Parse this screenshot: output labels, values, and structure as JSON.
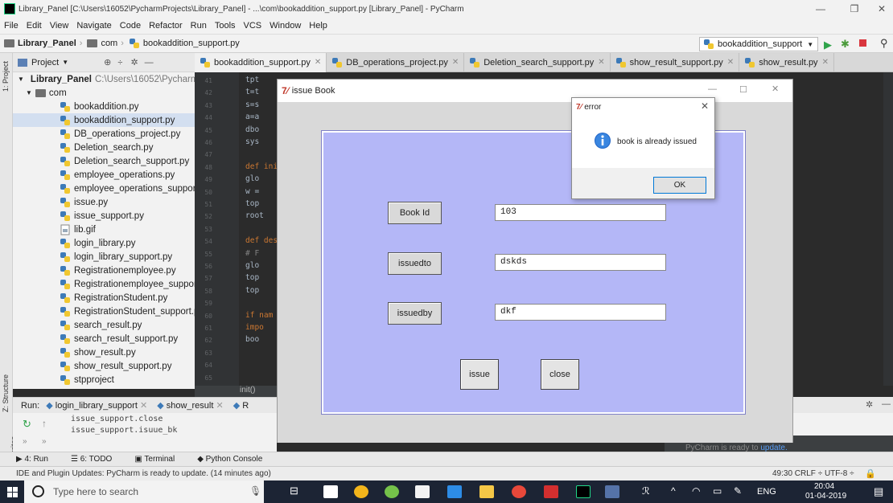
{
  "ide": {
    "window_title": "Library_Panel [C:\\Users\\16052\\PycharmProjects\\Library_Panel] - ...\\com\\bookaddition_support.py [Library_Panel] - PyCharm",
    "menu": [
      "File",
      "Edit",
      "View",
      "Navigate",
      "Code",
      "Refactor",
      "Run",
      "Tools",
      "VCS",
      "Window",
      "Help"
    ],
    "breadcrumbs": [
      "Library_Panel",
      "com",
      "bookaddition_support.py"
    ],
    "run_config": "bookaddition_support",
    "project_panel_title": "Project",
    "side_labels": [
      "1: Project",
      "Z: Structure",
      "2: Favorites"
    ],
    "tree_root": {
      "name": "Library_Panel",
      "path": "C:\\Users\\16052\\Pycharm"
    },
    "tree_folder": "com",
    "tree_items": [
      "bookaddition.py",
      "bookaddition_support.py",
      "DB_operations_project.py",
      "Deletion_search.py",
      "Deletion_search_support.py",
      "employee_operations.py",
      "employee_operations_support.py",
      "issue.py",
      "issue_support.py",
      "lib.gif",
      "login_library.py",
      "login_library_support.py",
      "Registrationemployee.py",
      "Registrationemployee_support.py",
      "RegistrationStudent.py",
      "RegistrationStudent_support.py",
      "search_result.py",
      "search_result_support.py",
      "show_result.py",
      "show_result_support.py",
      "stpproject"
    ],
    "selected_item": "bookaddition_support.py",
    "editor_tabs": [
      "bookaddition_support.py",
      "DB_operations_project.py",
      "Deletion_search_support.py",
      "show_result_support.py",
      "show_result.py"
    ],
    "line_numbers": [
      "41",
      "42",
      "43",
      "44",
      "45",
      "46",
      "47",
      "48",
      "49",
      "50",
      "51",
      "52",
      "53",
      "54",
      "55",
      "56",
      "57",
      "58",
      "59",
      "60",
      "61",
      "62",
      "63",
      "64",
      "65"
    ],
    "code_lines": [
      "tpt",
      "t=t",
      "s=s",
      "a=a",
      "dbo",
      "sys",
      "",
      "def ini",
      "glo",
      "w =",
      "top",
      "root",
      "",
      "def des",
      "# F",
      "glo",
      "top",
      "top",
      "",
      "if nam",
      "impo",
      "boo",
      "",
      "",
      ""
    ],
    "editor_breadcrumb": "init()",
    "run_label": "Run:",
    "run_tabs": [
      "login_library_support",
      "show_result",
      "R"
    ],
    "console_lines": [
      "issue_support.close",
      "issue_support.isuue_bk"
    ],
    "notification": "PyCharm is ready to",
    "notification_link": "update.",
    "bottom_tools": [
      "4: Run",
      "6: TODO",
      "Terminal",
      "Python Console"
    ],
    "status_message": "IDE and Plugin Updates: PyCharm is ready to update. (14 minutes ago)",
    "status_right": "49:30  CRLF ÷  UTF-8 ÷"
  },
  "tk": {
    "title": "issue Book",
    "fields": [
      {
        "label": "Book Id",
        "value": "103"
      },
      {
        "label": "issuedto",
        "value": "dskds"
      },
      {
        "label": "issuedby",
        "value": "dkf"
      }
    ],
    "buttons": {
      "issue": "issue",
      "close": "close"
    },
    "frame_color": "#b4b7f7"
  },
  "dialog": {
    "title": "error",
    "message": "book is already issued",
    "ok": "OK"
  },
  "taskbar": {
    "search_placeholder": "Type here to search",
    "lang": "ENG",
    "time": "20:04",
    "date": "01-04-2019"
  }
}
